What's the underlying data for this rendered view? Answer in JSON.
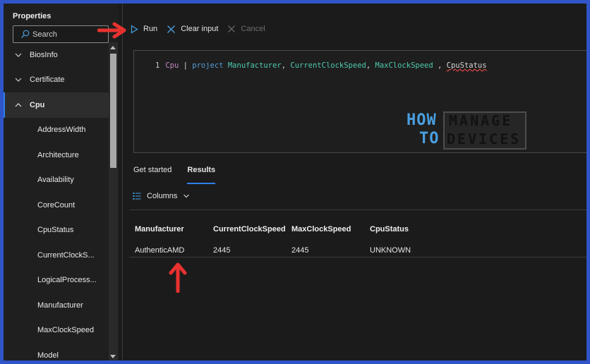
{
  "sidebar": {
    "title": "Properties",
    "search_placeholder": "Search",
    "items": [
      {
        "label": "BiosInfo",
        "kind": "group",
        "expanded": false
      },
      {
        "label": "Certificate",
        "kind": "group",
        "expanded": false
      },
      {
        "label": "Cpu",
        "kind": "group",
        "expanded": true,
        "selected": true
      },
      {
        "label": "AddressWidth",
        "kind": "child"
      },
      {
        "label": "Architecture",
        "kind": "child"
      },
      {
        "label": "Availability",
        "kind": "child"
      },
      {
        "label": "CoreCount",
        "kind": "child"
      },
      {
        "label": "CpuStatus",
        "kind": "child"
      },
      {
        "label": "CurrentClockS...",
        "kind": "child"
      },
      {
        "label": "LogicalProcess...",
        "kind": "child"
      },
      {
        "label": "Manufacturer",
        "kind": "child"
      },
      {
        "label": "MaxClockSpeed",
        "kind": "child"
      },
      {
        "label": "Model",
        "kind": "child"
      }
    ]
  },
  "toolbar": {
    "run_label": "Run",
    "clear_label": "Clear input",
    "cancel_label": "Cancel"
  },
  "editor": {
    "line_number": "1",
    "tokens": {
      "table": "Cpu",
      "pipe": " | ",
      "op": "project",
      "col1": " Manufacturer",
      "sep1": ", ",
      "col2": "CurrentClockSpeed",
      "sep2": ", ",
      "col3": "MaxClockSpeed",
      "sep3": " , ",
      "col4": "CpuStatus"
    }
  },
  "watermark": {
    "how": "HOW",
    "to": "TO",
    "manage": "MANAGE",
    "devices": "DEVICES"
  },
  "tabs": [
    {
      "label": "Get started",
      "active": false
    },
    {
      "label": "Results",
      "active": true
    }
  ],
  "columns_label": "Columns",
  "results": {
    "headers": [
      "Manufacturer",
      "CurrentClockSpeed",
      "MaxClockSpeed",
      "CpuStatus"
    ],
    "rows": [
      [
        "AuthenticAMD",
        "2445",
        "2445",
        "UNKNOWN"
      ]
    ]
  },
  "colors": {
    "accent": "#2f80ed",
    "annotation": "#e8322f",
    "border_frame": "#2f55c8"
  }
}
